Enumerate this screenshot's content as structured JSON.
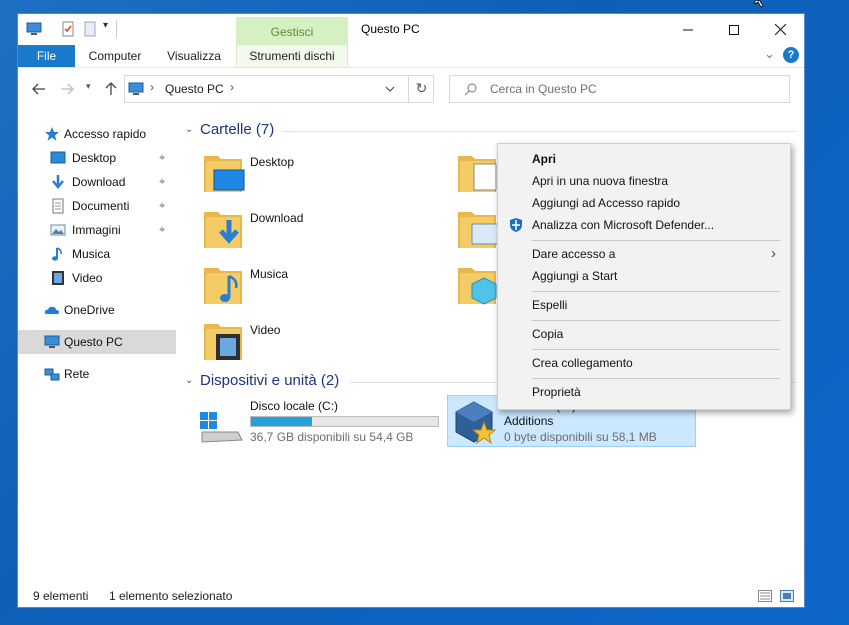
{
  "window": {
    "title": "Questo PC",
    "context_tab_header": "Gestisci",
    "controls": {
      "minimize": "—",
      "maximize": "☐",
      "close": "✕"
    }
  },
  "ribbon": {
    "tabs": [
      {
        "label": "File"
      },
      {
        "label": "Computer"
      },
      {
        "label": "Visualizza"
      },
      {
        "label": "Strumenti dischi"
      }
    ],
    "expand_glyph": "⌄",
    "help_glyph": "?"
  },
  "address": {
    "crumb": "Questo PC",
    "separator": "›",
    "search_placeholder": "Cerca in Questo PC"
  },
  "nav_pane": {
    "items": [
      {
        "label": "Accesso rapido",
        "icon": "star-icon"
      },
      {
        "label": "Desktop",
        "icon": "desktop-icon",
        "pinned": true
      },
      {
        "label": "Download",
        "icon": "download-icon",
        "pinned": true
      },
      {
        "label": "Documenti",
        "icon": "document-icon",
        "pinned": true
      },
      {
        "label": "Immagini",
        "icon": "image-icon",
        "pinned": true
      },
      {
        "label": "Musica",
        "icon": "music-icon"
      },
      {
        "label": "Video",
        "icon": "video-icon"
      },
      {
        "label": "OneDrive",
        "icon": "cloud-icon"
      },
      {
        "label": "Questo PC",
        "icon": "computer-icon",
        "selected": true
      },
      {
        "label": "Rete",
        "icon": "network-icon"
      }
    ],
    "pin_glyph": "📌"
  },
  "groups": {
    "folders_header": "Cartelle (7)",
    "devices_header": "Dispositivi e unità (2)"
  },
  "folders": [
    {
      "label": "Desktop"
    },
    {
      "label": "Download"
    },
    {
      "label": "Musica"
    },
    {
      "label": "Video"
    }
  ],
  "drives": {
    "c": {
      "label": "Disco locale (C:)",
      "sub": "36,7 GB disponibili su 54,4 GB",
      "used_fraction": 0.325
    },
    "d": {
      "label": "Unità CD (D:) VirtualBox Guest",
      "label2": "Additions",
      "sub": "0 byte disponibili su 58,1 MB"
    }
  },
  "status": {
    "count": "9 elementi",
    "selection": "1 elemento selezionato"
  },
  "context_menu": {
    "items": [
      {
        "label": "Apri",
        "bold": true
      },
      {
        "label": "Apri in una nuova finestra"
      },
      {
        "label": "Aggiungi ad Accesso rapido"
      },
      {
        "label": "Analizza con Microsoft Defender..."
      },
      {
        "label": "Dare accesso a",
        "submenu": true
      },
      {
        "label": "Aggiungi a Start"
      },
      {
        "label": "Espelli"
      },
      {
        "label": "Copia"
      },
      {
        "label": "Crea collegamento"
      },
      {
        "label": "Proprietà"
      }
    ],
    "submenu_glyph": "›"
  },
  "colors": {
    "accent": "#1979ca",
    "context_tab": "#d7f0c3",
    "selection": "#cce8ff",
    "drive_fill": "#26a0da",
    "folder": "#f3cc66"
  }
}
